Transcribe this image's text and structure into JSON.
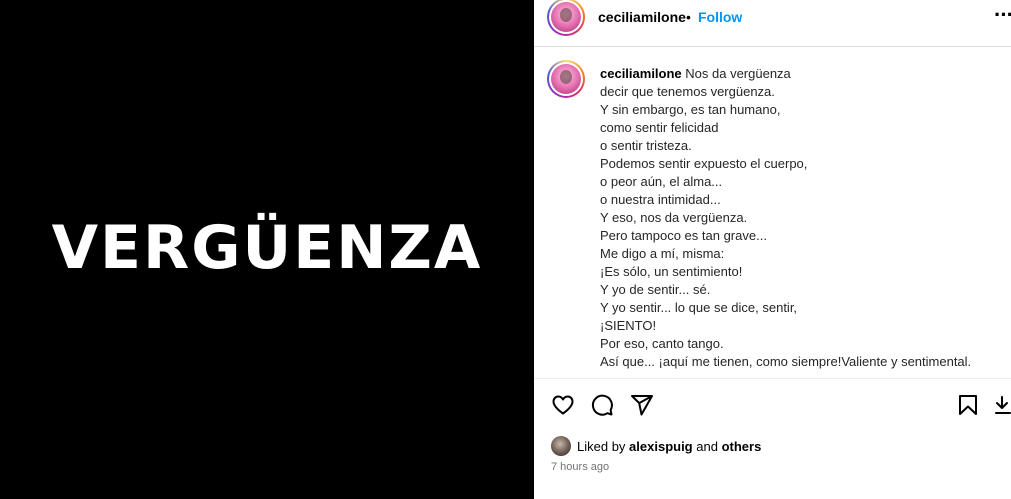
{
  "media": {
    "text": "VERGÜENZA"
  },
  "post": {
    "username": "ceciliamilone",
    "separator": "•",
    "follow_label": "Follow",
    "more_icon": "more-horizontal-icon",
    "caption_username": "ceciliamilone",
    "caption_text": " Nos da vergüenza\ndecir que tenemos vergüenza.\nY sin embargo, es tan humano,\ncomo sentir felicidad\no sentir tristeza.\nPodemos sentir expuesto el cuerpo,\no peor aún, el alma...\no nuestra intimidad...\nY eso, nos da vergüenza.\nPero tampoco es tan grave...\nMe digo a mí, misma:\n¡Es sólo, un sentimiento!\nY yo de sentir... sé.\nY yo sentir... lo que se dice, sentir,\n¡SIENTO!\nPor eso, canto tango.\nAsí que... ¡aquí me tienen, como siempre!Valiente y sentimental."
  },
  "actions": {
    "icons": [
      "heart-icon",
      "comment-icon",
      "send-icon",
      "bookmark-icon",
      "download-icon"
    ]
  },
  "likes": {
    "prefix": "Liked by",
    "user": "alexispuig",
    "joiner": "and",
    "others": "others"
  },
  "time": "7 hours ago"
}
